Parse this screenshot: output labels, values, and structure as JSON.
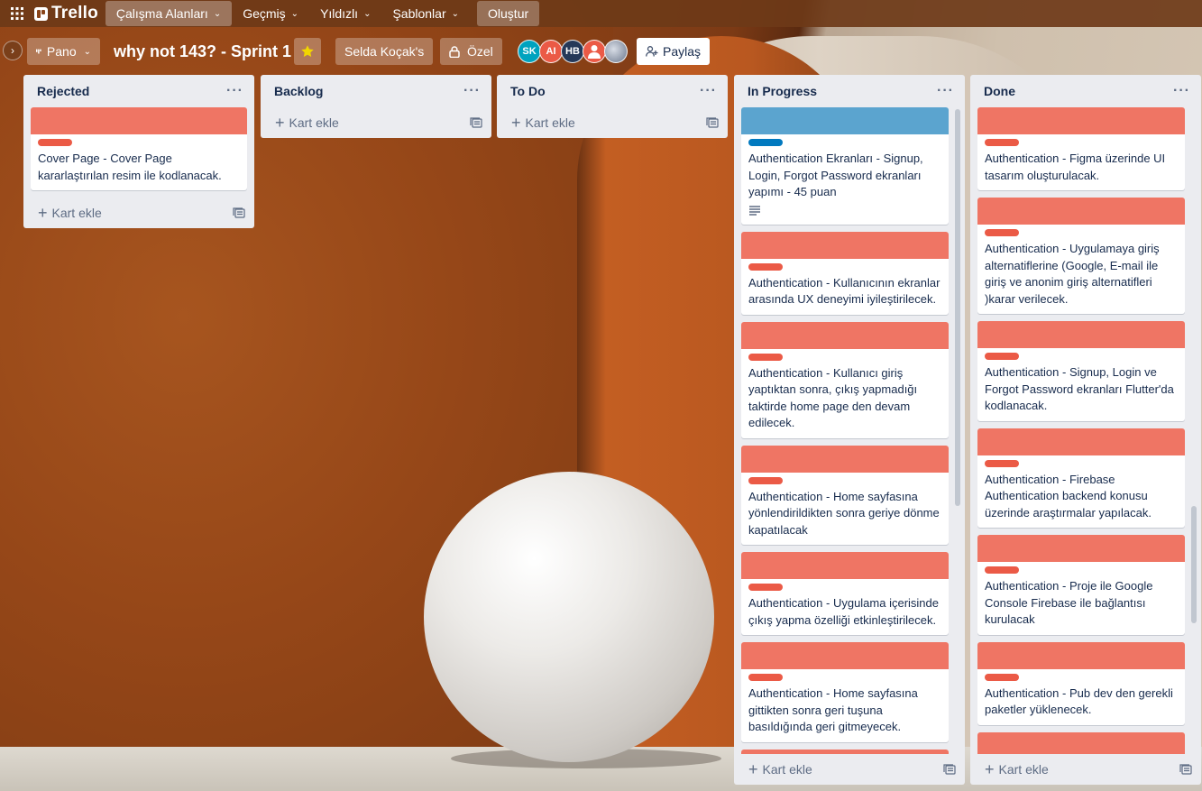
{
  "header": {
    "logo_text": "Trello",
    "nav": [
      {
        "label": "Çalışma Alanları",
        "active": true
      },
      {
        "label": "Geçmiş",
        "active": false
      },
      {
        "label": "Yıldızlı",
        "active": false
      },
      {
        "label": "Şablonlar",
        "active": false
      }
    ],
    "create_label": "Oluştur"
  },
  "board": {
    "view_label": "Pano",
    "title": "why not 143? - Sprint 1",
    "workspace_label": "Selda Koçak's",
    "visibility_label": "Özel",
    "share_label": "Paylaş",
    "star_color": "#f2d600",
    "members": [
      {
        "initials": "SK",
        "color": "#00a3bf"
      },
      {
        "initials": "AI",
        "color": "#eb5a46"
      },
      {
        "initials": "HB",
        "color": "#253858"
      },
      {
        "initials": "",
        "color": "#eb5a46",
        "icon": "person-icon"
      },
      {
        "initials": "",
        "color": "#6b778c",
        "icon": "photo-avatar"
      }
    ]
  },
  "lists": [
    {
      "title": "Rejected",
      "add_label": "Kart ekle",
      "cards": [
        {
          "text": "Cover Page - Cover Page kararlaştırılan resim ile kodlanacak.",
          "cover": "#ef7564",
          "label": "#eb5a46"
        }
      ]
    },
    {
      "title": "Backlog",
      "add_label": "Kart ekle",
      "cards": []
    },
    {
      "title": "To Do",
      "add_label": "Kart ekle",
      "cards": []
    },
    {
      "title": "In Progress",
      "add_label": "Kart ekle",
      "cards": [
        {
          "text": "Authentication Ekranları - Signup, Login, Forgot Password ekranları yapımı - 45 puan",
          "cover": "#5ba4cf",
          "label": "#0079bf",
          "has_description": true
        },
        {
          "text": "Authentication - Kullanıcının ekranlar arasında UX deneyimi iyileştirilecek.",
          "cover": "#ef7564",
          "label": "#eb5a46"
        },
        {
          "text": "Authentication - Kullanıcı giriş yaptıktan sonra, çıkış yapmadığı taktirde home page den devam edilecek.",
          "cover": "#ef7564",
          "label": "#eb5a46"
        },
        {
          "text": "Authentication - Home sayfasına yönlendirildikten sonra geriye dönme kapatılacak",
          "cover": "#ef7564",
          "label": "#eb5a46"
        },
        {
          "text": "Authentication - Uygulama içerisinde çıkış yapma özelliği etkinleştirilecek.",
          "cover": "#ef7564",
          "label": "#eb5a46"
        },
        {
          "text": "Authentication - Home sayfasına gittikten sonra geri tuşuna basıldığında geri gitmeyecek.",
          "cover": "#ef7564",
          "label": "#eb5a46"
        }
      ]
    },
    {
      "title": "Done",
      "add_label": "Kart ekle",
      "cards": [
        {
          "text": "Authentication - Figma üzerinde UI tasarım oluşturulacak.",
          "cover": "#ef7564",
          "label": "#eb5a46"
        },
        {
          "text": "Authentication - Uygulamaya giriş alternatiflerine (Google, E-mail ile giriş ve anonim giriş alternatifleri )karar verilecek.",
          "cover": "#ef7564",
          "label": "#eb5a46"
        },
        {
          "text": "Authentication - Signup, Login ve Forgot Password ekranları Flutter'da kodlanacak.",
          "cover": "#ef7564",
          "label": "#eb5a46"
        },
        {
          "text": "Authentication - Firebase Authentication backend konusu üzerinde araştırmalar yapılacak.",
          "cover": "#ef7564",
          "label": "#eb5a46"
        },
        {
          "text": "Authentication - Proje ile Google Console Firebase ile bağlantısı kurulacak",
          "cover": "#ef7564",
          "label": "#eb5a46"
        },
        {
          "text": "Authentication - Pub dev den gerekli paketler yüklenecek.",
          "cover": "#ef7564",
          "label": "#eb5a46"
        }
      ]
    }
  ]
}
